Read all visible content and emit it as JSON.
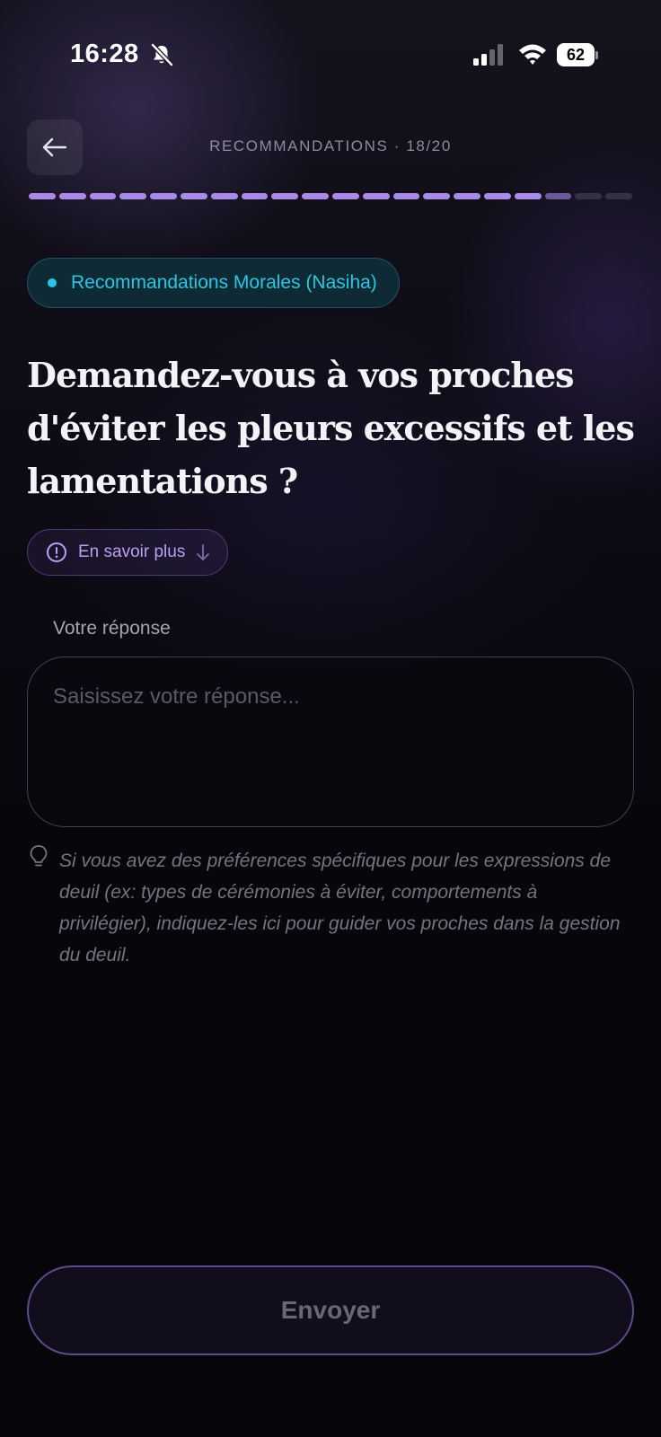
{
  "status_bar": {
    "time": "16:28",
    "battery": "62"
  },
  "header": {
    "back_icon": "arrow-left-icon",
    "step_label": "RECOMMANDATIONS · 18/20"
  },
  "progress": {
    "current_step": 18,
    "total_steps": 20,
    "color_done": "#a98ae8"
  },
  "category": {
    "label": "Recommandations Morales (Nasiha)",
    "color": "#2cc6e2"
  },
  "question": {
    "text": "Demandez-vous à vos proches d'éviter les pleurs excessifs et les lamentations ?"
  },
  "learn_more": {
    "label": "En savoir plus"
  },
  "answer": {
    "label": "Votre réponse",
    "placeholder": "Saisissez votre réponse..."
  },
  "hint": {
    "text": "Si vous avez des préférences spécifiques pour les expressions de deuil (ex: types de cérémonies à éviter, comportements à privilégier), indiquez-les ici pour guider vos proches dans la gestion du deuil."
  },
  "submit": {
    "label": "Envoyer"
  }
}
